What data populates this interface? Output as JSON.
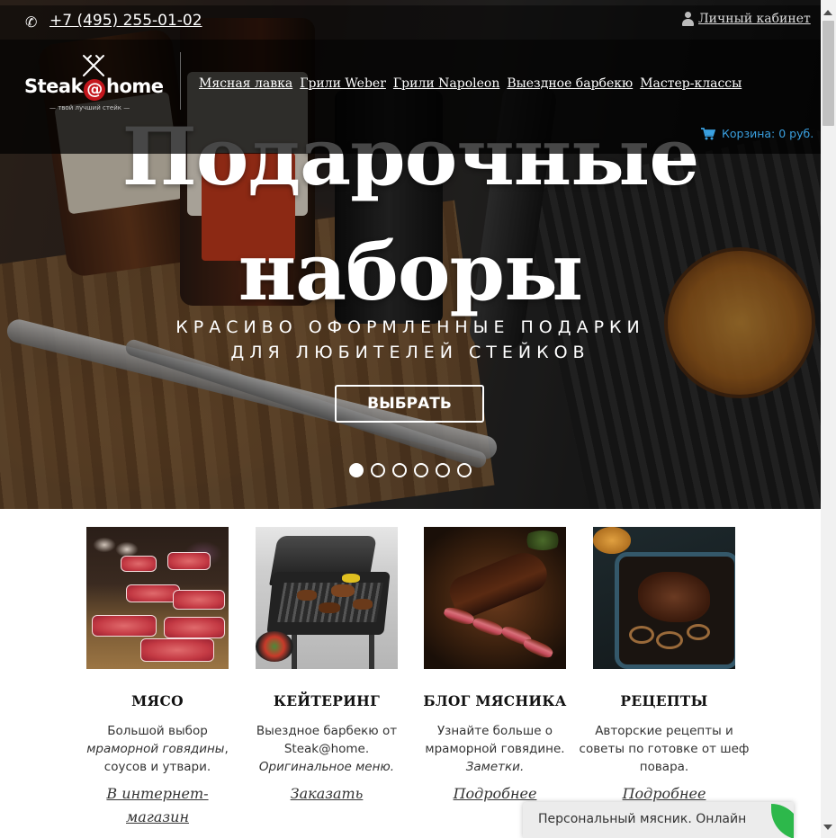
{
  "topbar": {
    "phone_icon": "phone-icon",
    "phone": "+7 (495) 255-01-02",
    "user_icon": "user-icon",
    "cabinet_label": "Личный кабинет"
  },
  "header": {
    "logo_name_part1": "Steak",
    "logo_at": "@",
    "logo_name_part2": "home",
    "logo_tagline": "— твой лучший стейк —",
    "nav": [
      {
        "label": "Мясная лавка"
      },
      {
        "label": "Грили Weber"
      },
      {
        "label": "Грили Napoleon"
      },
      {
        "label": "Выездное барбекю"
      },
      {
        "label": "Мастер-классы"
      }
    ],
    "cart_icon": "cart-icon",
    "cart_label": "Корзина: 0 руб.",
    "cart_color": "#3aa0e0"
  },
  "hero": {
    "title_line1": "Подарочные",
    "title_line2": "наборы",
    "subtitle_line1": "КРАСИВО ОФОРМЛЕННЫЕ ПОДАРКИ",
    "subtitle_line2": "ДЛЯ ЛЮБИТЕЛЕЙ СТЕЙКОВ",
    "button_label": "ВЫБРАТЬ",
    "slides_total": 6,
    "active_slide": 1
  },
  "cards": [
    {
      "title": "МЯСО",
      "text_before": "Большой выбор ",
      "text_em": "мраморной говядины",
      "text_after": ", соусов и утвари.",
      "link": "В интернет-магазин"
    },
    {
      "title": "КЕЙТЕРИНГ",
      "text_before": "Выездное барбекю от Steak@home. ",
      "text_em": "Оригинальное меню.",
      "text_after": "",
      "link": "Заказать"
    },
    {
      "title": "БЛОГ МЯСНИКА",
      "text_before": "Узнайте больше о мраморной говядине. ",
      "text_em": "Заметки.",
      "text_after": "",
      "link": "Подробнее"
    },
    {
      "title": "РЕЦЕПТЫ",
      "text_before": "Авторские рецепты и советы по готовке от шеф повара.",
      "text_em": "",
      "text_after": "",
      "link": "Подробнее"
    }
  ],
  "chat": {
    "label": "Персональный мясник. Онлайн",
    "accent": "#2db84b"
  }
}
